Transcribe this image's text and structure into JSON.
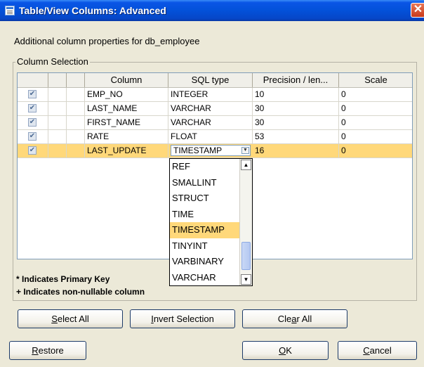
{
  "window": {
    "title": "Table/View Columns: Advanced",
    "close_label": "✕"
  },
  "description": "Additional column properties for db_employee",
  "group_label": "Column Selection",
  "grid": {
    "headers": [
      "",
      "",
      "",
      "Column",
      "SQL type",
      "Precision / len...",
      "Scale"
    ],
    "rows": [
      {
        "checked": true,
        "check": "✔",
        "column": "EMP_NO",
        "sql_type": "INTEGER",
        "precision": "10",
        "scale": "0"
      },
      {
        "checked": true,
        "check": "✔",
        "column": "LAST_NAME",
        "sql_type": "VARCHAR",
        "precision": "30",
        "scale": "0"
      },
      {
        "checked": true,
        "check": "✔",
        "column": "FIRST_NAME",
        "sql_type": "VARCHAR",
        "precision": "30",
        "scale": "0"
      },
      {
        "checked": true,
        "check": "✔",
        "column": "RATE",
        "sql_type": "FLOAT",
        "precision": "53",
        "scale": "0"
      },
      {
        "checked": true,
        "check": "✔",
        "column": "LAST_UPDATE",
        "sql_type": "TIMESTAMP",
        "precision": "16",
        "scale": "0"
      }
    ],
    "selected_row": 4
  },
  "dropdown": {
    "options": [
      "REF",
      "SMALLINT",
      "STRUCT",
      "TIME",
      "TIMESTAMP",
      "TINYINT",
      "VARBINARY",
      "VARCHAR"
    ],
    "highlighted": "TIMESTAMP",
    "scroll_up": "▲",
    "scroll_down": "▼",
    "combo_arrow": "▼"
  },
  "notes": {
    "primary_key": "* Indicates Primary Key",
    "non_nullable": "+ Indicates non-nullable column"
  },
  "buttons": {
    "select_all": {
      "pre": "",
      "key": "S",
      "post": "elect All"
    },
    "invert_selection": {
      "pre": "",
      "key": "I",
      "post": "nvert Selection"
    },
    "clear_all": {
      "pre": "Cle",
      "key": "a",
      "post": "r All"
    },
    "restore": {
      "pre": "",
      "key": "R",
      "post": "estore"
    },
    "ok": {
      "pre": "",
      "key": "O",
      "post": "K"
    },
    "cancel": {
      "pre": "",
      "key": "C",
      "post": "ancel"
    }
  },
  "colors": {
    "selection": "#ffd87a",
    "titlebar": "#0351d9"
  }
}
